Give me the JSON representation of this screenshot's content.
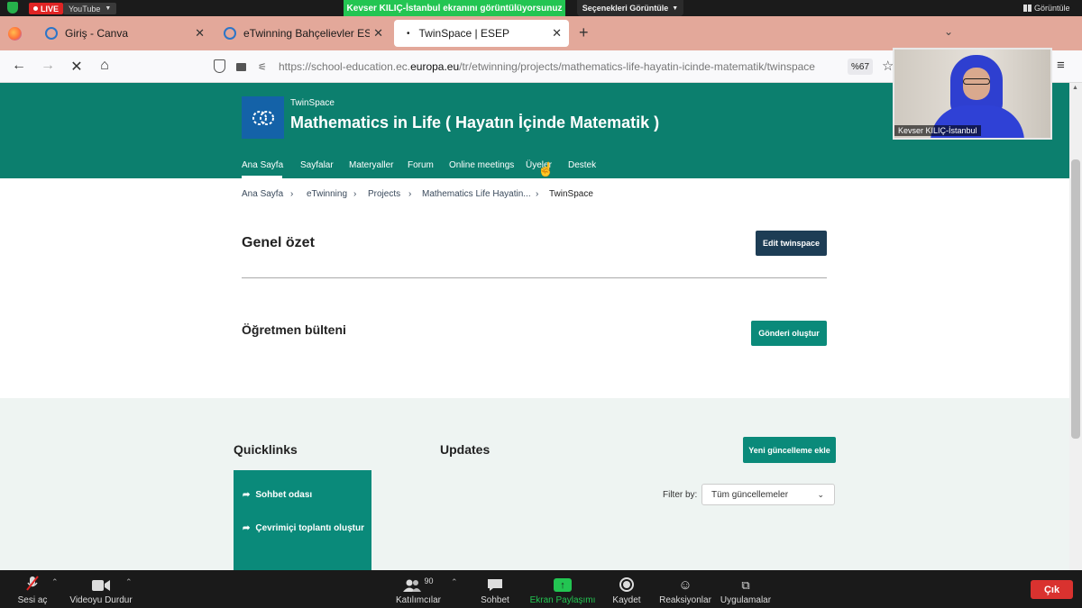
{
  "zoom_top": {
    "live_label": "LIVE",
    "youtube_label": "YouTube",
    "share_banner": "Kevser KILIÇ-İstanbul ekranını görüntülüyorsunuz",
    "view_options": "Seçenekleri Görüntüle",
    "view_label": "Görüntüle"
  },
  "browser": {
    "tabs": [
      {
        "label": "Giriş - Canva"
      },
      {
        "label": "eTwinning Bahçelievler ESEP Bi..."
      },
      {
        "label": "TwinSpace | ESEP"
      }
    ],
    "url_prefix": "https://school-education.ec.",
    "url_host": "europa.eu",
    "url_path": "/tr/etwinning/projects/mathematics-life-hayatin-icinde-matematik/twinspace",
    "zoom": "%67"
  },
  "video": {
    "name": "Kevser KILIÇ-İstanbul"
  },
  "site": {
    "kicker": "TwinSpace",
    "title": "Mathematics in Life ( Hayatın İçinde Matematik )",
    "nav": [
      "Ana Sayfa",
      "Sayfalar",
      "Materyaller",
      "Forum",
      "Online meetings",
      "Üyeler",
      "Destek"
    ],
    "breadcrumb": [
      "Ana Sayfa",
      "eTwinning",
      "Projects",
      "Mathematics Life Hayatin...",
      "TwinSpace"
    ],
    "overview_title": "Genel özet",
    "edit_button": "Edit twinspace",
    "bulletin_title": "Öğretmen bülteni",
    "post_button": "Gönderi oluştur",
    "quicklinks_title": "Quicklinks",
    "quicklinks": [
      "Sohbet odası",
      "Çevrimiçi toplantı oluştur"
    ],
    "updates_title": "Updates",
    "add_update_button": "Yeni güncelleme ekle",
    "filter_label": "Filter by:",
    "filter_value": "Tüm güncellemeler"
  },
  "zoom_bar": {
    "mute": "Sesi aç",
    "video": "Videoyu Durdur",
    "participants": "Katılımcılar",
    "participants_count": "90",
    "chat": "Sohbet",
    "share": "Ekran Paylaşımı",
    "record": "Kaydet",
    "reactions": "Reaksiyonlar",
    "apps": "Uygulamalar",
    "leave": "Çık"
  },
  "colors": {
    "teal_header": "#0c7f6e",
    "teal_button": "#0a8a7a",
    "navy_button": "#1d3d55",
    "tab_bar": "#e3a89a",
    "share_green": "#23c552",
    "leave_red": "#d9322f"
  }
}
